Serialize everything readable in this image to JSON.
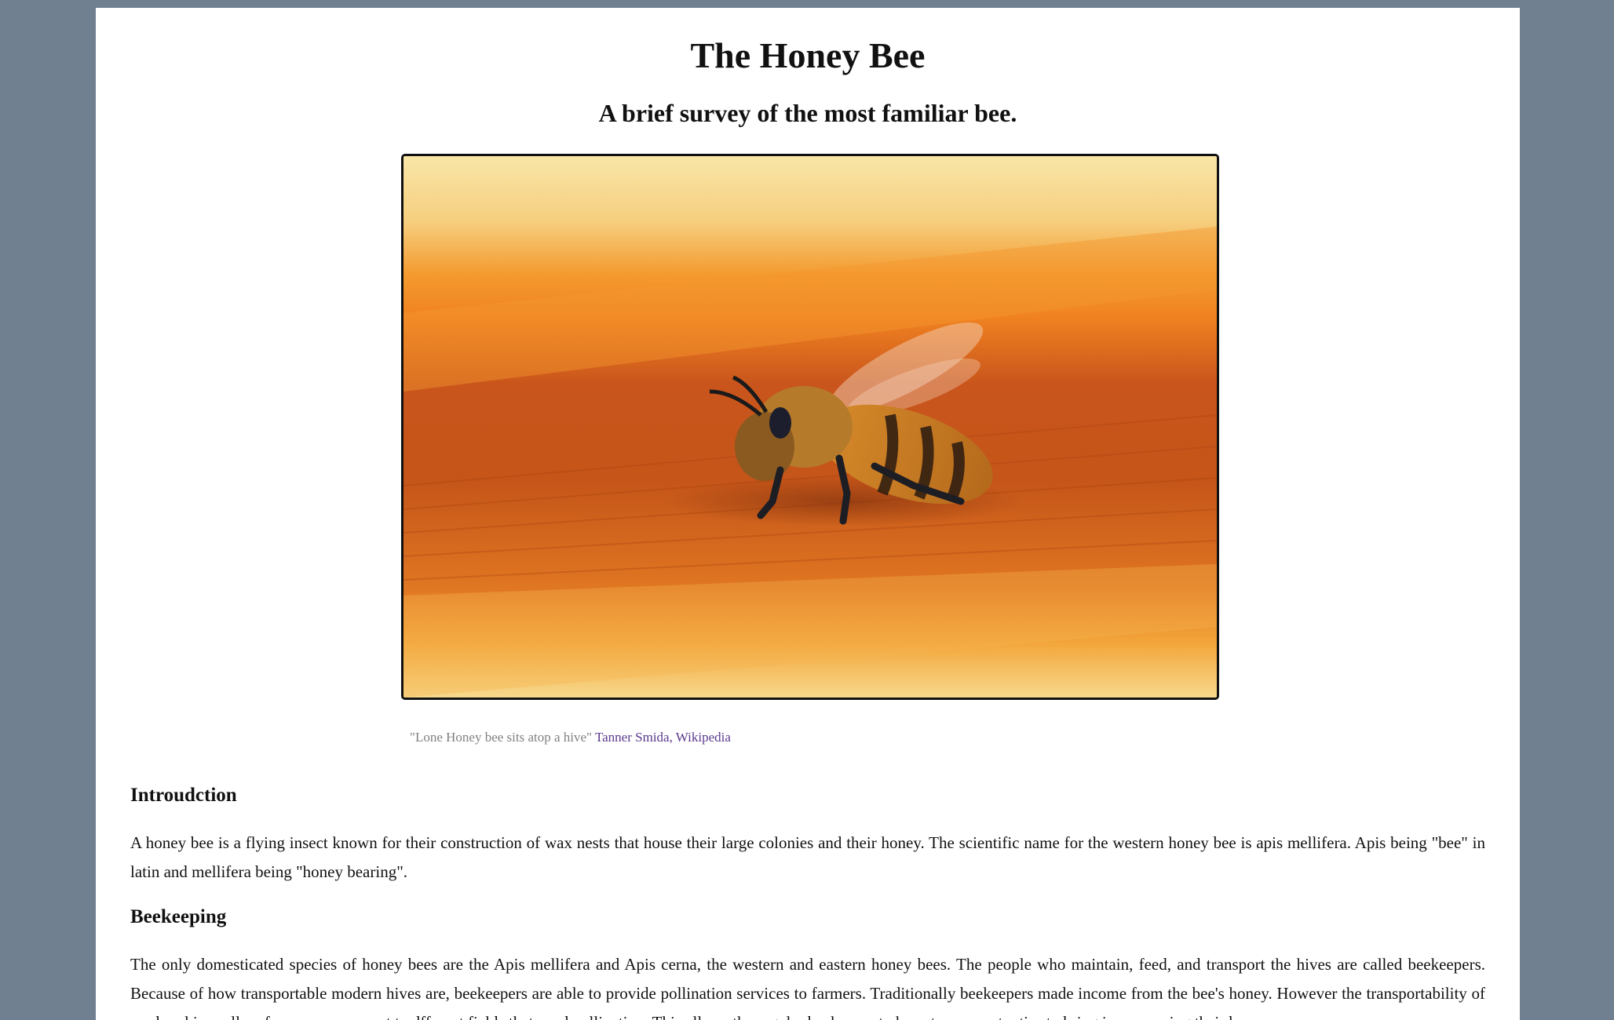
{
  "header": {
    "title": "The Honey Bee",
    "subtitle": "A brief survey of the most familiar bee."
  },
  "figure": {
    "caption_quote": "\"Lone Honey bee sits atop a hive\"",
    "caption_link": "Tanner Smida, Wikipedia"
  },
  "sections": [
    {
      "heading": "Introudction",
      "text": "A honey bee is a flying insect known for their construction of wax nests that house their large colonies and their honey. The scientific name for the western honey bee is apis mellifera. Apis being \"bee\" in latin and mellifera being \"honey bearing\"."
    },
    {
      "heading": "Beekeeping",
      "text": "The only domesticated species of honey bees are the Apis mellifera and Apis cerna, the western and eastern honey bees. The people who maintain, feed, and transport the hives are called beekeepers. Because of how transportable modern hives are, beekeepers are able to provide pollination services to farmers. Traditionally beekeepers made income from the bee's honey. However the transportability of modern hives allow for easy movement to dfferent fields that need pollination. This allows the regular beekeeper to have two opportunties to bring income using their bee"
    }
  ],
  "colors": {
    "background": "#708090",
    "page": "#ffffff",
    "link": "#5b3a8e",
    "caption": "#808080"
  }
}
